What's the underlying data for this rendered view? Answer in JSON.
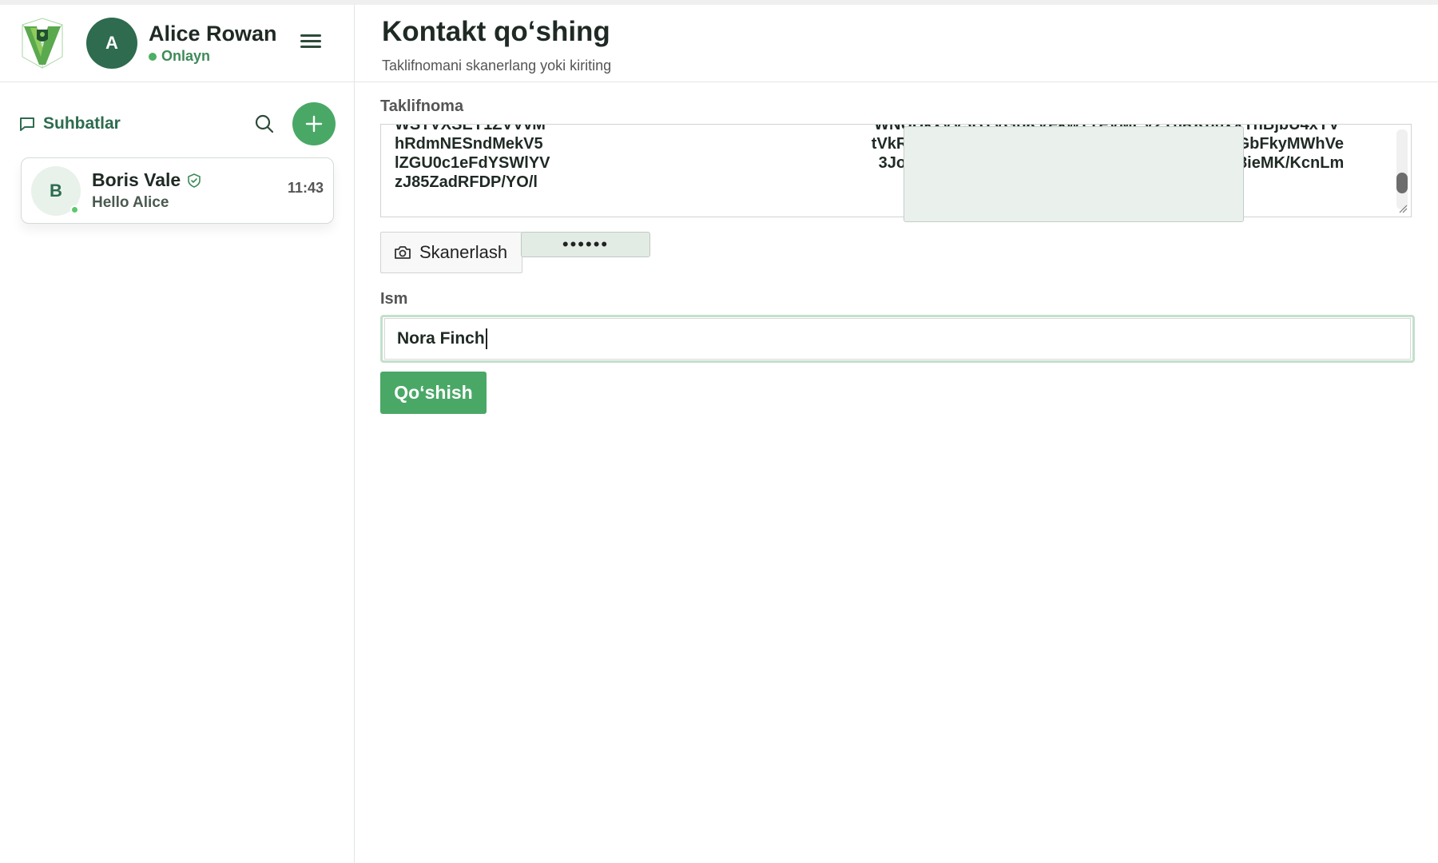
{
  "user": {
    "initial": "A",
    "name": "Alice Rowan",
    "status": "Onlayn"
  },
  "sidebar": {
    "section_title": "Suhbatlar",
    "chats": [
      {
        "initial": "B",
        "name": "Boris Vale",
        "preview": "Hello Alice",
        "time": "11:43",
        "verified": true,
        "online": true
      }
    ]
  },
  "main": {
    "title": "Kontakt qoʻshing",
    "subtitle": "Taklifnomani skanerlang yoki kiriting",
    "invite_label": "Taklifnoma",
    "invite_lines": [
      "WSTVXSEY1ZVVvM                                                                          WNUUkxVV3BTVGpKVFkwTTFVMEV2Y0RKd0xXTnBjbU4xYV",
      "hRdmNESndMekV5                                                                          tVkROa1ptRkdNbXBhUjNKR2RuUnJNemhDTW5GbFkyMWhVe",
      "lZGU0c1eFdYSWlYV                                                                          3JoJCRneB+ywHMOJqjwWo4ma0/EtxIVN7pvx58ieMK/KcnLm",
      "zJ85ZadRFDP/YO/l"
    ],
    "scan_label": "Skanerlash",
    "password_mask": "••••••",
    "name_label": "Ism",
    "name_value": "Nora Finch",
    "submit_label": "Qoʻshish"
  },
  "colors": {
    "accent": "#4aa866",
    "brand_dark": "#2e6b4f"
  }
}
